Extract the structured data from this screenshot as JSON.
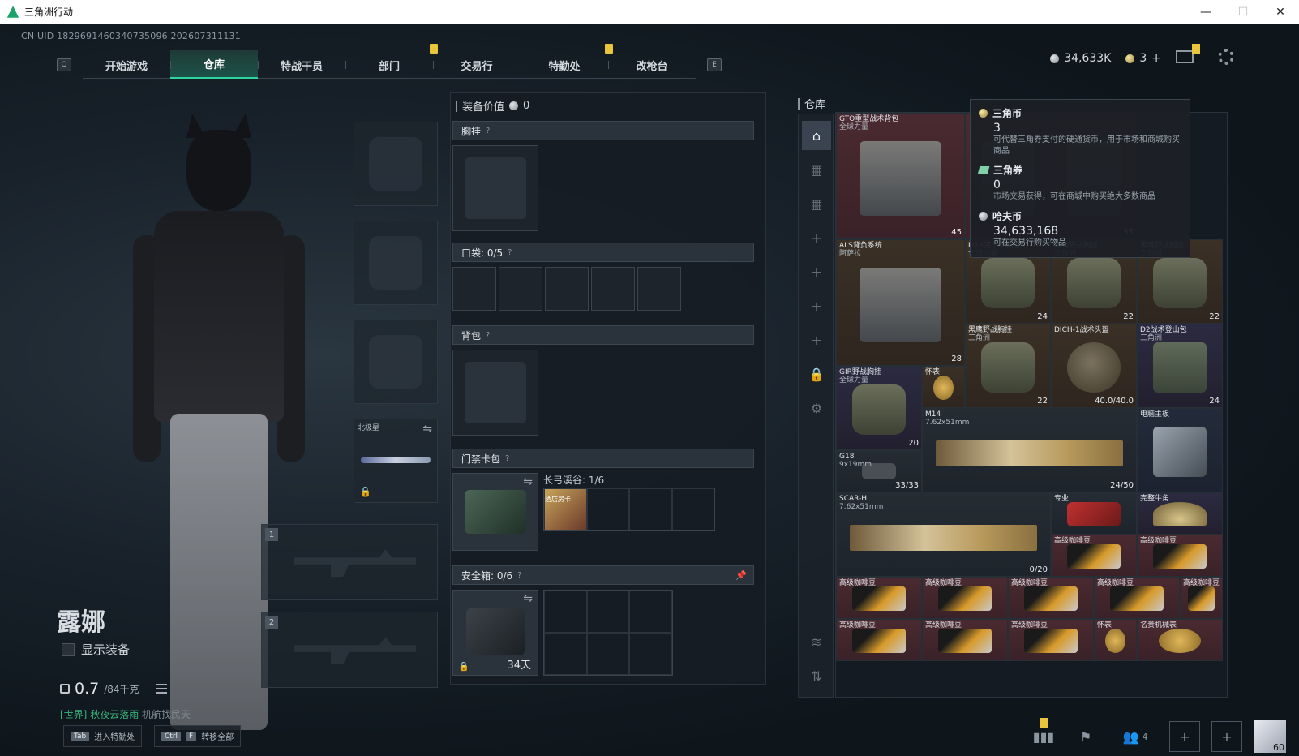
{
  "window": {
    "title": "三角洲行动",
    "min": "—",
    "max": "☐",
    "close": "✕"
  },
  "uid": "CN UID 1829691460340735096 202607311131",
  "nav": {
    "left_key": "Q",
    "right_key": "E",
    "tabs": [
      "开始游戏",
      "仓库",
      "特战干员",
      "部门",
      "交易行",
      "特勤处",
      "改枪台"
    ],
    "active_tab": "仓库"
  },
  "currency": {
    "hafcoin": "34,633K",
    "triangle_coin": "3",
    "add": "+"
  },
  "character": {
    "name": "露娜",
    "show_gear_label": "显示装备",
    "weight_current": "0.7",
    "weight_max": "/84千克",
    "chat_channel": "[世界]",
    "chat_user": "秋夜云落雨",
    "chat_message": "机航找民天"
  },
  "equip_slots": {
    "melee_label": "北极星",
    "weapon1_num": "1",
    "weapon2_num": "2"
  },
  "gear_panel": {
    "value_label": "装备价值",
    "value": "0",
    "chest_rig": "胸挂",
    "pockets": "口袋: 0/5",
    "backpack": "背包",
    "keycard": "门禁卡包",
    "keycard_map": "长弓溪谷: 1/6",
    "keycard_item": "酒店房卡",
    "safe_box": "安全箱: 0/6",
    "safe_days": "34天",
    "qmark": "?"
  },
  "storage": {
    "title": "仓库",
    "items": [
      {
        "name": "GTO重型战术背包",
        "sub": "全球力量",
        "cnt": "45",
        "style": "red",
        "art": "pack2"
      },
      {
        "name": "",
        "sub": "",
        "cnt": "40",
        "style": "red",
        "art": "pack"
      },
      {
        "name": "",
        "sub": "",
        "cnt": "35",
        "style": "red",
        "art": "pack"
      },
      {
        "name": "ALS背负系统",
        "sub": "阿萨拉",
        "cnt": "28",
        "style": "gold",
        "art": "pack2"
      },
      {
        "name": "DAR突击手胸挂",
        "sub": "全球力量",
        "cnt": "24",
        "style": "gold",
        "art": "vest"
      },
      {
        "name": "黑鹰野战胸挂",
        "sub": "三角洲",
        "cnt": "22",
        "style": "gold",
        "art": "vest"
      },
      {
        "name": "黑鹰野战胸挂",
        "sub": "三角洲",
        "cnt": "22",
        "style": "gold",
        "art": "vest"
      },
      {
        "name": "黑鹰野战胸挂",
        "sub": "三角洲",
        "cnt": "22",
        "style": "gold",
        "art": "vest"
      },
      {
        "name": "DICH-1战术头盔",
        "sub": "",
        "cnt": "40.0/40.0",
        "style": "gold",
        "art": "helmet"
      },
      {
        "name": "D2战术登山包",
        "sub": "三角洲",
        "cnt": "24",
        "style": "purple",
        "art": "pack"
      },
      {
        "name": "GIR野战胸挂",
        "sub": "全球力量",
        "cnt": "20",
        "style": "purple",
        "art": "vest"
      },
      {
        "name": "怀表",
        "sub": "",
        "cnt": "",
        "style": "gold",
        "art": "watch"
      },
      {
        "name": "M14",
        "sub": "7.62x51mm",
        "cnt": "24/50",
        "style": "gray",
        "art": "rifle"
      },
      {
        "name": "电脑主板",
        "sub": "",
        "cnt": "",
        "style": "blue",
        "art": "board"
      },
      {
        "name": "G18",
        "sub": "9x19mm",
        "cnt": "33/33",
        "style": "gray",
        "art": "pistol"
      },
      {
        "name": "SCAR-H",
        "sub": "7.62x51mm",
        "cnt": "0/20",
        "style": "gray",
        "art": "rifle"
      },
      {
        "name": "专业",
        "sub": "",
        "cnt": "",
        "style": "gray",
        "art": "card"
      },
      {
        "name": "完整牛角",
        "sub": "",
        "cnt": "",
        "style": "purple",
        "art": "horn"
      },
      {
        "name": "高级咖啡豆",
        "sub": "",
        "cnt": "",
        "style": "red",
        "art": "coffee"
      },
      {
        "name": "高级咖啡豆",
        "sub": "",
        "cnt": "",
        "style": "red",
        "art": "coffee"
      },
      {
        "name": "高级咖啡豆",
        "sub": "",
        "cnt": "",
        "style": "red",
        "art": "coffee"
      },
      {
        "name": "高级咖啡豆",
        "sub": "",
        "cnt": "",
        "style": "red",
        "art": "coffee"
      },
      {
        "name": "高级咖啡豆",
        "sub": "",
        "cnt": "",
        "style": "red",
        "art": "coffee"
      },
      {
        "name": "高级咖啡豆",
        "sub": "",
        "cnt": "",
        "style": "red",
        "art": "coffee"
      },
      {
        "name": "高级咖啡豆",
        "sub": "",
        "cnt": "",
        "style": "red",
        "art": "coffee"
      },
      {
        "name": "高级咖啡豆",
        "sub": "",
        "cnt": "",
        "style": "red",
        "art": "coffee"
      },
      {
        "name": "高级咖啡豆",
        "sub": "",
        "cnt": "",
        "style": "red",
        "art": "coffee"
      },
      {
        "name": "高级咖啡豆",
        "sub": "",
        "cnt": "",
        "style": "red",
        "art": "coffee"
      },
      {
        "name": "怀表",
        "sub": "",
        "cnt": "",
        "style": "red",
        "art": "watch"
      },
      {
        "name": "名贵机械表",
        "sub": "",
        "cnt": "",
        "style": "red",
        "art": "watch"
      }
    ]
  },
  "tooltip": {
    "coin_title": "三角币",
    "coin_value": "3",
    "coin_desc": "可代替三角券支付的硬通货币，用于市场和商城购买商品",
    "ticket_title": "三角券",
    "ticket_value": "0",
    "ticket_desc": "市场交易获得，可在商城中购买绝大多数商品",
    "haf_title": "哈夫币",
    "haf_value": "34,633,168",
    "haf_desc": "可在交易行购买物品"
  },
  "bottom": {
    "hint1_key": "Tab",
    "hint1_label": "进入特勤处",
    "hint2_key1": "Ctrl",
    "hint2_key2": "F",
    "hint2_label": "转移全部",
    "friends_count": "4",
    "avatar_level": "60"
  },
  "colors": {
    "accent": "#2fd39c",
    "notif": "#e8c53a"
  }
}
